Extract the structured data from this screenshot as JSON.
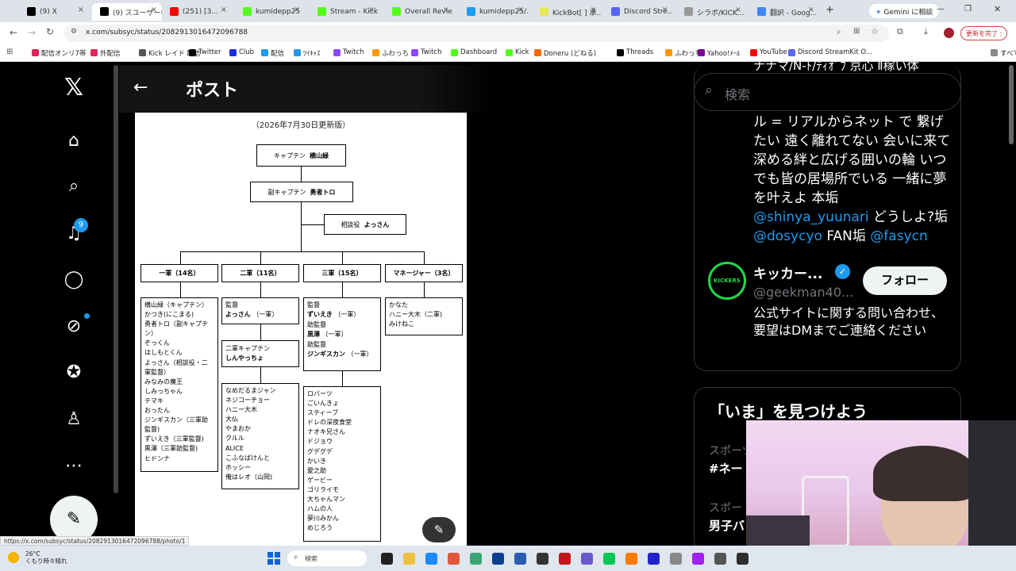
{
  "browser": {
    "tabs": [
      {
        "label": "(9) X",
        "color": "#000000"
      },
      {
        "label": "(9) スユーザー様...",
        "color": "#000000"
      },
      {
        "label": "(251) [3...",
        "color": "#ff0000"
      },
      {
        "label": "kumidepp25",
        "color": "#53fc18"
      },
      {
        "label": "Stream - Kick",
        "color": "#53fc18"
      },
      {
        "label": "Overall Revie",
        "color": "#53fc18"
      },
      {
        "label": "kumidepp25/...",
        "color": "#1d9bf0"
      },
      {
        "label": "KickBot[ ] 承...",
        "color": "#e8e85a"
      },
      {
        "label": "Discord Stre...",
        "color": "#5865f2"
      },
      {
        "label": "シラボ/KICK...",
        "color": "#999999"
      },
      {
        "label": "翻訳 - Goog...",
        "color": "#4285f4"
      }
    ],
    "gemini_label": "Gemini に相談",
    "url": "x.com/subsyc/status/2082913016472096788",
    "profile_label": "更新を完了 :",
    "bookmarks": [
      {
        "label": "配信オンリ7帯",
        "color": "#e0245e"
      },
      {
        "label": "外配信",
        "color": "#e0245e"
      },
      {
        "label": "Kick レイド 配信",
        "color": "#555555"
      },
      {
        "label": "Twitter",
        "color": "#000000"
      },
      {
        "label": "Club",
        "color": "#1d2bdc"
      },
      {
        "label": "配信",
        "color": "#1d9bf0"
      },
      {
        "label": "ﾂｲｷｬｽ",
        "color": "#1d9bf0"
      },
      {
        "label": "Twitch",
        "color": "#9146ff"
      },
      {
        "label": "ふわっち",
        "color": "#ff9900"
      },
      {
        "label": "Twitch",
        "color": "#9146ff"
      },
      {
        "label": "Dashboard",
        "color": "#53fc18"
      },
      {
        "label": "Kick",
        "color": "#53fc18"
      },
      {
        "label": "Doneru (どねる)",
        "color": "#ff6600"
      },
      {
        "label": "Threads",
        "color": "#000000"
      },
      {
        "label": "ふわっち",
        "color": "#ff9900"
      },
      {
        "label": "Yahoo!ﾒｰﾙ",
        "color": "#7b0099"
      },
      {
        "label": "YouTube",
        "color": "#ff0000"
      },
      {
        "label": "Discord StreamKit O...",
        "color": "#5865f2"
      },
      {
        "label": "すべてのブックマーク",
        "color": "#888888"
      }
    ]
  },
  "x": {
    "notif_count": "9",
    "post_header": "ポスト",
    "search_placeholder": "検索",
    "bio_top_fragment": "ナナマ/N-ﾄ/ﾃｨｵﾞﾌ 京心 Ⅱ稼い体",
    "bio": {
      "text1": "ル = リアルからネット で 繋げたい 遠く離れてない 会いに来て 深める絆と広げる囲いの輪 いつでも皆の居場所でいる 一緒に夢を叶えよ 本垢",
      "link1": "@shinya_yuunari",
      "text2": " どうしよ?垢",
      "link2": "@dosycyo",
      "text3": " FAN垢 ",
      "link3": "@fasycn"
    },
    "suggested": {
      "avatar_text": "KICKERS",
      "name": "キッカー...",
      "handle": "@geekman40...",
      "follow_label": "フォロー",
      "description": "公式サイトに関する問い合わせ、要望はDMまでご連絡ください"
    },
    "trends_title": "「いま」を見つけよう",
    "trends": [
      {
        "category": "スポーツ",
        "name": "#ネー"
      },
      {
        "category": "スポー",
        "name": "男子バ"
      }
    ]
  },
  "doc": {
    "update_note": "（2026年7月30日更新版）",
    "captain": {
      "role": "キャプテン",
      "name": "横山緑"
    },
    "vice": {
      "role": "副キャプテン",
      "name": "勇者トロ"
    },
    "advisor": {
      "role": "相談役",
      "name": "よっさん"
    },
    "divisions": [
      "一軍（14名）",
      "二軍（11名）",
      "三軍（15名）",
      "マネージャー（3名）"
    ],
    "ichi_members": "横山緑（キャプテン）\nかつき(にこまる)\n勇者トロ（副キャプテ\nン）\nぞっくん\nはしもとくん\nよっさん（相談役・二\n軍監督）\nみなみの魔王\nしみっちゃん\nテマキ\nおったん\nジンギスカン（三軍助\n監督)\nずいえき（三軍監督)\n黒澤（三軍助監督)\nヒドンナ",
    "ni_coach_role": "監督",
    "ni_coach": "よっさん",
    "ni_coach_note": "（一軍）",
    "ni_captain_role": "二軍キャプテン",
    "ni_captain": "しんやっちょ",
    "ni_members": "なめだるまジャン\nネジコーチョー\nハニー大木\n大仏\nやまおか\nクルル\nALICE\nこふなばけんと\nホッシー\n俺はレオ（山岡)",
    "san_coach_role": "監督",
    "san_coach": "ずいえき",
    "san_coach_note": "（一軍）",
    "san_asst1_role": "助監督",
    "san_asst1": "黒澤",
    "san_asst1_note": "（一軍）",
    "san_asst2_role": "助監督",
    "san_asst2": "ジンギスカン",
    "san_asst2_note": "（一軍）",
    "san_members": "ロバーツ\nごいんきょ\nスティーブ\nドレの深夜食堂\nナオキ兄さん\nドジョウ\nグデグデ\nかいき\n愛之助\nゲービー\nゴリライモ\n大ちゃんマン\nハムの人\n夢川みかん\nめじろう",
    "managers": "かなた\nハニー大木（二軍)\nみけねこ"
  },
  "statusbar": {
    "url": "https://x.com/subsyc/status/2082913016472096788/photo/1"
  },
  "taskbar": {
    "temp": "26°C",
    "weather": "くもり時々晴れ",
    "search": "検索"
  }
}
